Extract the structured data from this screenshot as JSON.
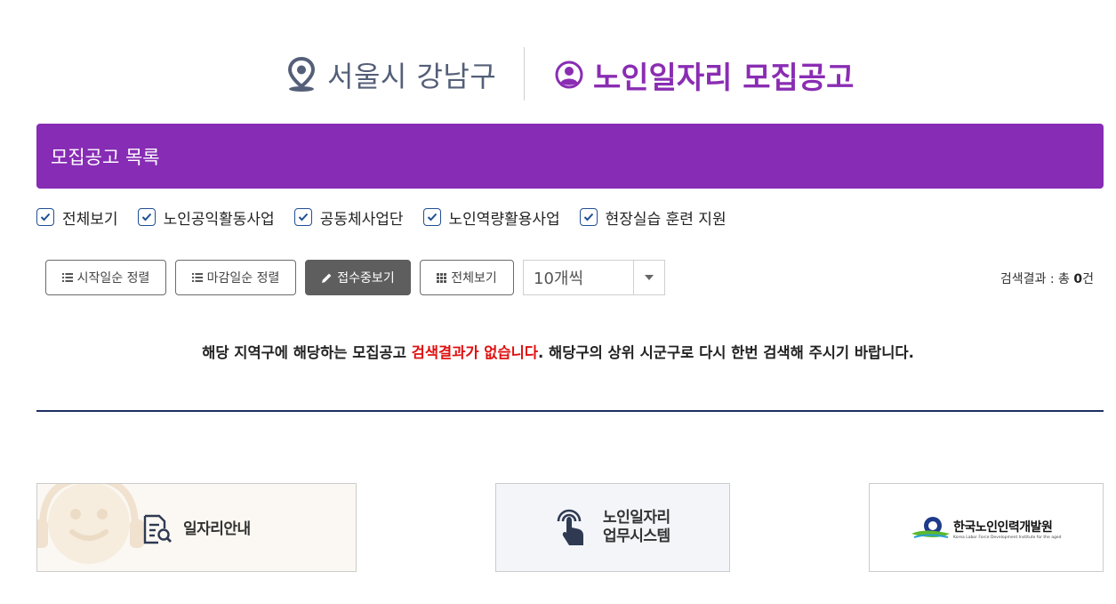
{
  "header": {
    "location": "서울시 강남구",
    "title": "노인일자리 모집공고"
  },
  "list_bar": {
    "title": "모집공고 목록"
  },
  "filters": [
    {
      "label": "전체보기",
      "checked": true
    },
    {
      "label": "노인공익활동사업",
      "checked": true
    },
    {
      "label": "공동체사업단",
      "checked": true
    },
    {
      "label": "노인역량활용사업",
      "checked": true
    },
    {
      "label": "현장실습 훈련 지원",
      "checked": true
    }
  ],
  "controls": {
    "sort_start": "시작일순 정렬",
    "sort_end": "마감일순 정렬",
    "view_open": "접수중보기",
    "view_all": "전체보기",
    "page_size": "10개씩"
  },
  "result": {
    "label": "검색결과 : 총",
    "count": "0",
    "unit": "건"
  },
  "message": {
    "part1": "해당 지역구에 해당하는 모집공고 ",
    "highlight": "검색결과가 없습니다",
    "part2": ". 해당구의 상위 시군구로 다시 한번 검색해 주시기 바랍니다."
  },
  "cards": {
    "job_info": "일자리안내",
    "system_line1": "노인일자리",
    "system_line2": "업무시스템",
    "logo_ko": "한국노인인력개발원",
    "logo_en": "Korea Labor Force Development Institute for the aged"
  },
  "colors": {
    "brand_purple": "#872cb5",
    "title_purple": "#8a2db3",
    "highlight_red": "#e01010",
    "navy": "#1e3062"
  }
}
